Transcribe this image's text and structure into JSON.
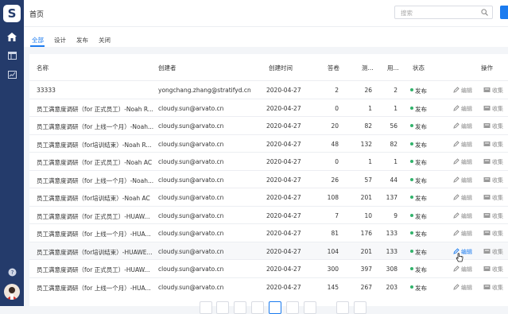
{
  "sidebar": {
    "logo_letter": "S"
  },
  "header": {
    "title": "首页",
    "search_placeholder": "搜索"
  },
  "tabs": [
    {
      "label": "全部"
    },
    {
      "label": "设计"
    },
    {
      "label": "发布"
    },
    {
      "label": "关闭"
    }
  ],
  "table": {
    "columns": [
      "名称",
      "创建者",
      "创建时间",
      "答卷",
      "测...",
      "用...",
      "状态",
      "操作"
    ],
    "edit_label": "编辑",
    "collect_label": "收集",
    "rows": [
      {
        "name": "33333",
        "creator": "yongchang.zhang@stratifyd.cn",
        "date": "2020-04-27",
        "answers": "2",
        "c5": "26",
        "c6": "2",
        "status": "发布"
      },
      {
        "name": "员工满意度调研（for 正式员工）-Noah R...",
        "creator": "cloudy.sun@arvato.cn",
        "date": "2020-04-27",
        "answers": "0",
        "c5": "1",
        "c6": "1",
        "status": "发布"
      },
      {
        "name": "员工满意度调研（for 上线一个月）-Noah...",
        "creator": "cloudy.sun@arvato.cn",
        "date": "2020-04-27",
        "answers": "20",
        "c5": "82",
        "c6": "56",
        "status": "发布"
      },
      {
        "name": "员工满意度调研（for培训结束）-Noah R...",
        "creator": "cloudy.sun@arvato.cn",
        "date": "2020-04-27",
        "answers": "48",
        "c5": "132",
        "c6": "82",
        "status": "发布"
      },
      {
        "name": "员工满意度调研（for 正式员工）-Noah AC",
        "creator": "cloudy.sun@arvato.cn",
        "date": "2020-04-27",
        "answers": "0",
        "c5": "1",
        "c6": "1",
        "status": "发布"
      },
      {
        "name": "员工满意度调研（for 上线一个月）-Noah...",
        "creator": "cloudy.sun@arvato.cn",
        "date": "2020-04-27",
        "answers": "26",
        "c5": "57",
        "c6": "44",
        "status": "发布"
      },
      {
        "name": "员工满意度调研（for培训结束）-Noah AC",
        "creator": "cloudy.sun@arvato.cn",
        "date": "2020-04-27",
        "answers": "108",
        "c5": "201",
        "c6": "137",
        "status": "发布"
      },
      {
        "name": "员工满意度调研（for 正式员工）-HUAW...",
        "creator": "cloudy.sun@arvato.cn",
        "date": "2020-04-27",
        "answers": "7",
        "c5": "10",
        "c6": "9",
        "status": "发布"
      },
      {
        "name": "员工满意度调研（for 上线一个月）-HUA...",
        "creator": "cloudy.sun@arvato.cn",
        "date": "2020-04-27",
        "answers": "81",
        "c5": "176",
        "c6": "133",
        "status": "发布"
      },
      {
        "name": "员工满意度调研（for培训结束）-HUAWE...",
        "creator": "cloudy.sun@arvato.cn",
        "date": "2020-04-27",
        "answers": "104",
        "c5": "201",
        "c6": "133",
        "status": "发布"
      },
      {
        "name": "员工满意度调研（for 正式员工）-HUAW...",
        "creator": "cloudy.sun@arvato.cn",
        "date": "2020-04-27",
        "answers": "300",
        "c5": "397",
        "c6": "308",
        "status": "发布"
      },
      {
        "name": "员工满意度调研（for 上线一个月）-HUA...",
        "creator": "cloudy.sun@arvato.cn",
        "date": "2020-04-27",
        "answers": "145",
        "c5": "267",
        "c6": "203",
        "status": "发布"
      }
    ]
  },
  "colors": {
    "accent": "#1b7bef",
    "sidebar": "#243b6b",
    "status_green": "#32b36b"
  },
  "icons": {
    "search": "search-icon",
    "home": "home-icon",
    "edit": "pencil-icon",
    "collect": "inbox-icon",
    "help": "help-icon"
  }
}
